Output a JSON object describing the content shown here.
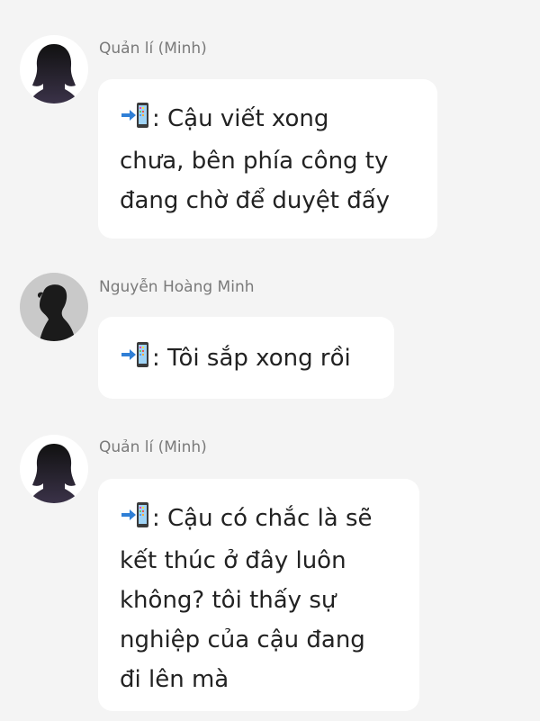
{
  "messages": [
    {
      "sender": "Quản lí (Minh)",
      "avatar": "female-silhouette-avatar",
      "icon": "mobile-phone-with-arrow-icon",
      "lines": [
        ": Cậu viết xong",
        "chưa, bên phía công ty",
        "đang chờ để duyệt đấy"
      ]
    },
    {
      "sender": "Nguyễn Hoàng Minh",
      "avatar": "male-silhouette-avatar",
      "icon": "mobile-phone-with-arrow-icon",
      "lines": [
        ": Tôi sắp xong rồi"
      ]
    },
    {
      "sender": "Quản lí (Minh)",
      "avatar": "female-silhouette-avatar",
      "icon": "mobile-phone-with-arrow-icon",
      "lines": [
        ": Cậu có chắc là sẽ",
        "kết thúc ở đây luôn",
        "không? tôi thấy sự",
        "nghiệp của cậu đang",
        "đi lên mà"
      ]
    }
  ],
  "colors": {
    "background": "#f4f4f4",
    "bubble": "#ffffff",
    "sender_text": "#7a7a7a",
    "message_text": "#222222",
    "arrow": "#2f7fd6",
    "phone_body": "#3a3a3a"
  }
}
